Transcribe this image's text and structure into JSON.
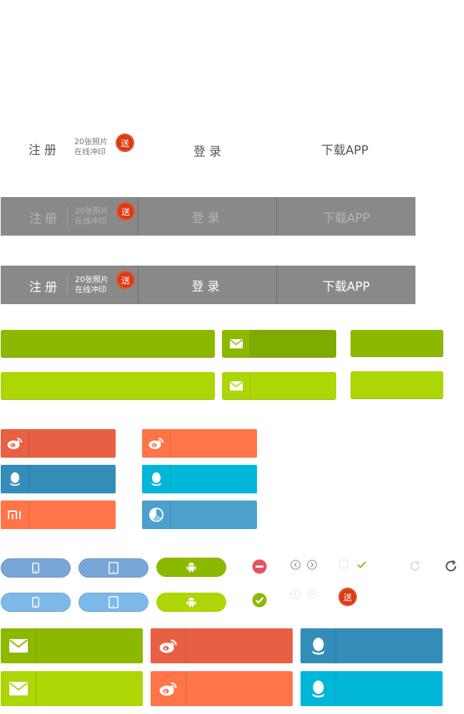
{
  "plain_row": {
    "register": "注册",
    "promo_line1": "20张照片",
    "promo_line2": "在线冲印",
    "badge": "送",
    "login": "登录",
    "download": "下载APP"
  },
  "nav_bar_dim": {
    "register": "注册",
    "promo_line1": "20张照片",
    "promo_line2": "在线冲印",
    "badge": "送",
    "login": "登录",
    "download": "下载APP"
  },
  "nav_bar_bright": {
    "register": "注册",
    "promo_line1": "20张照片",
    "promo_line2": "在线冲印",
    "badge": "送",
    "login": "登录",
    "download": "下载APP"
  },
  "misc": {
    "badge": "送"
  },
  "colors": {
    "green_dark": "#8cb800",
    "green_light": "#acd606",
    "weibo_red": "#e86043",
    "weibo_orange": "#ff7448",
    "qq_blue": "#338db8",
    "qq_cyan": "#00b7d9",
    "sky_blue": "#4ba1cc",
    "nav_gray": "#898989",
    "badge_red": "#d83b16"
  },
  "icons": [
    "mail-icon",
    "weibo-icon",
    "qq-icon",
    "xiaomi-icon",
    "pie-icon",
    "phone-icon",
    "tablet-icon",
    "android-icon",
    "minus-circle-icon",
    "check-circle-icon",
    "prev-icon",
    "next-icon",
    "checkbox-icon",
    "check-icon",
    "refresh-icon"
  ]
}
